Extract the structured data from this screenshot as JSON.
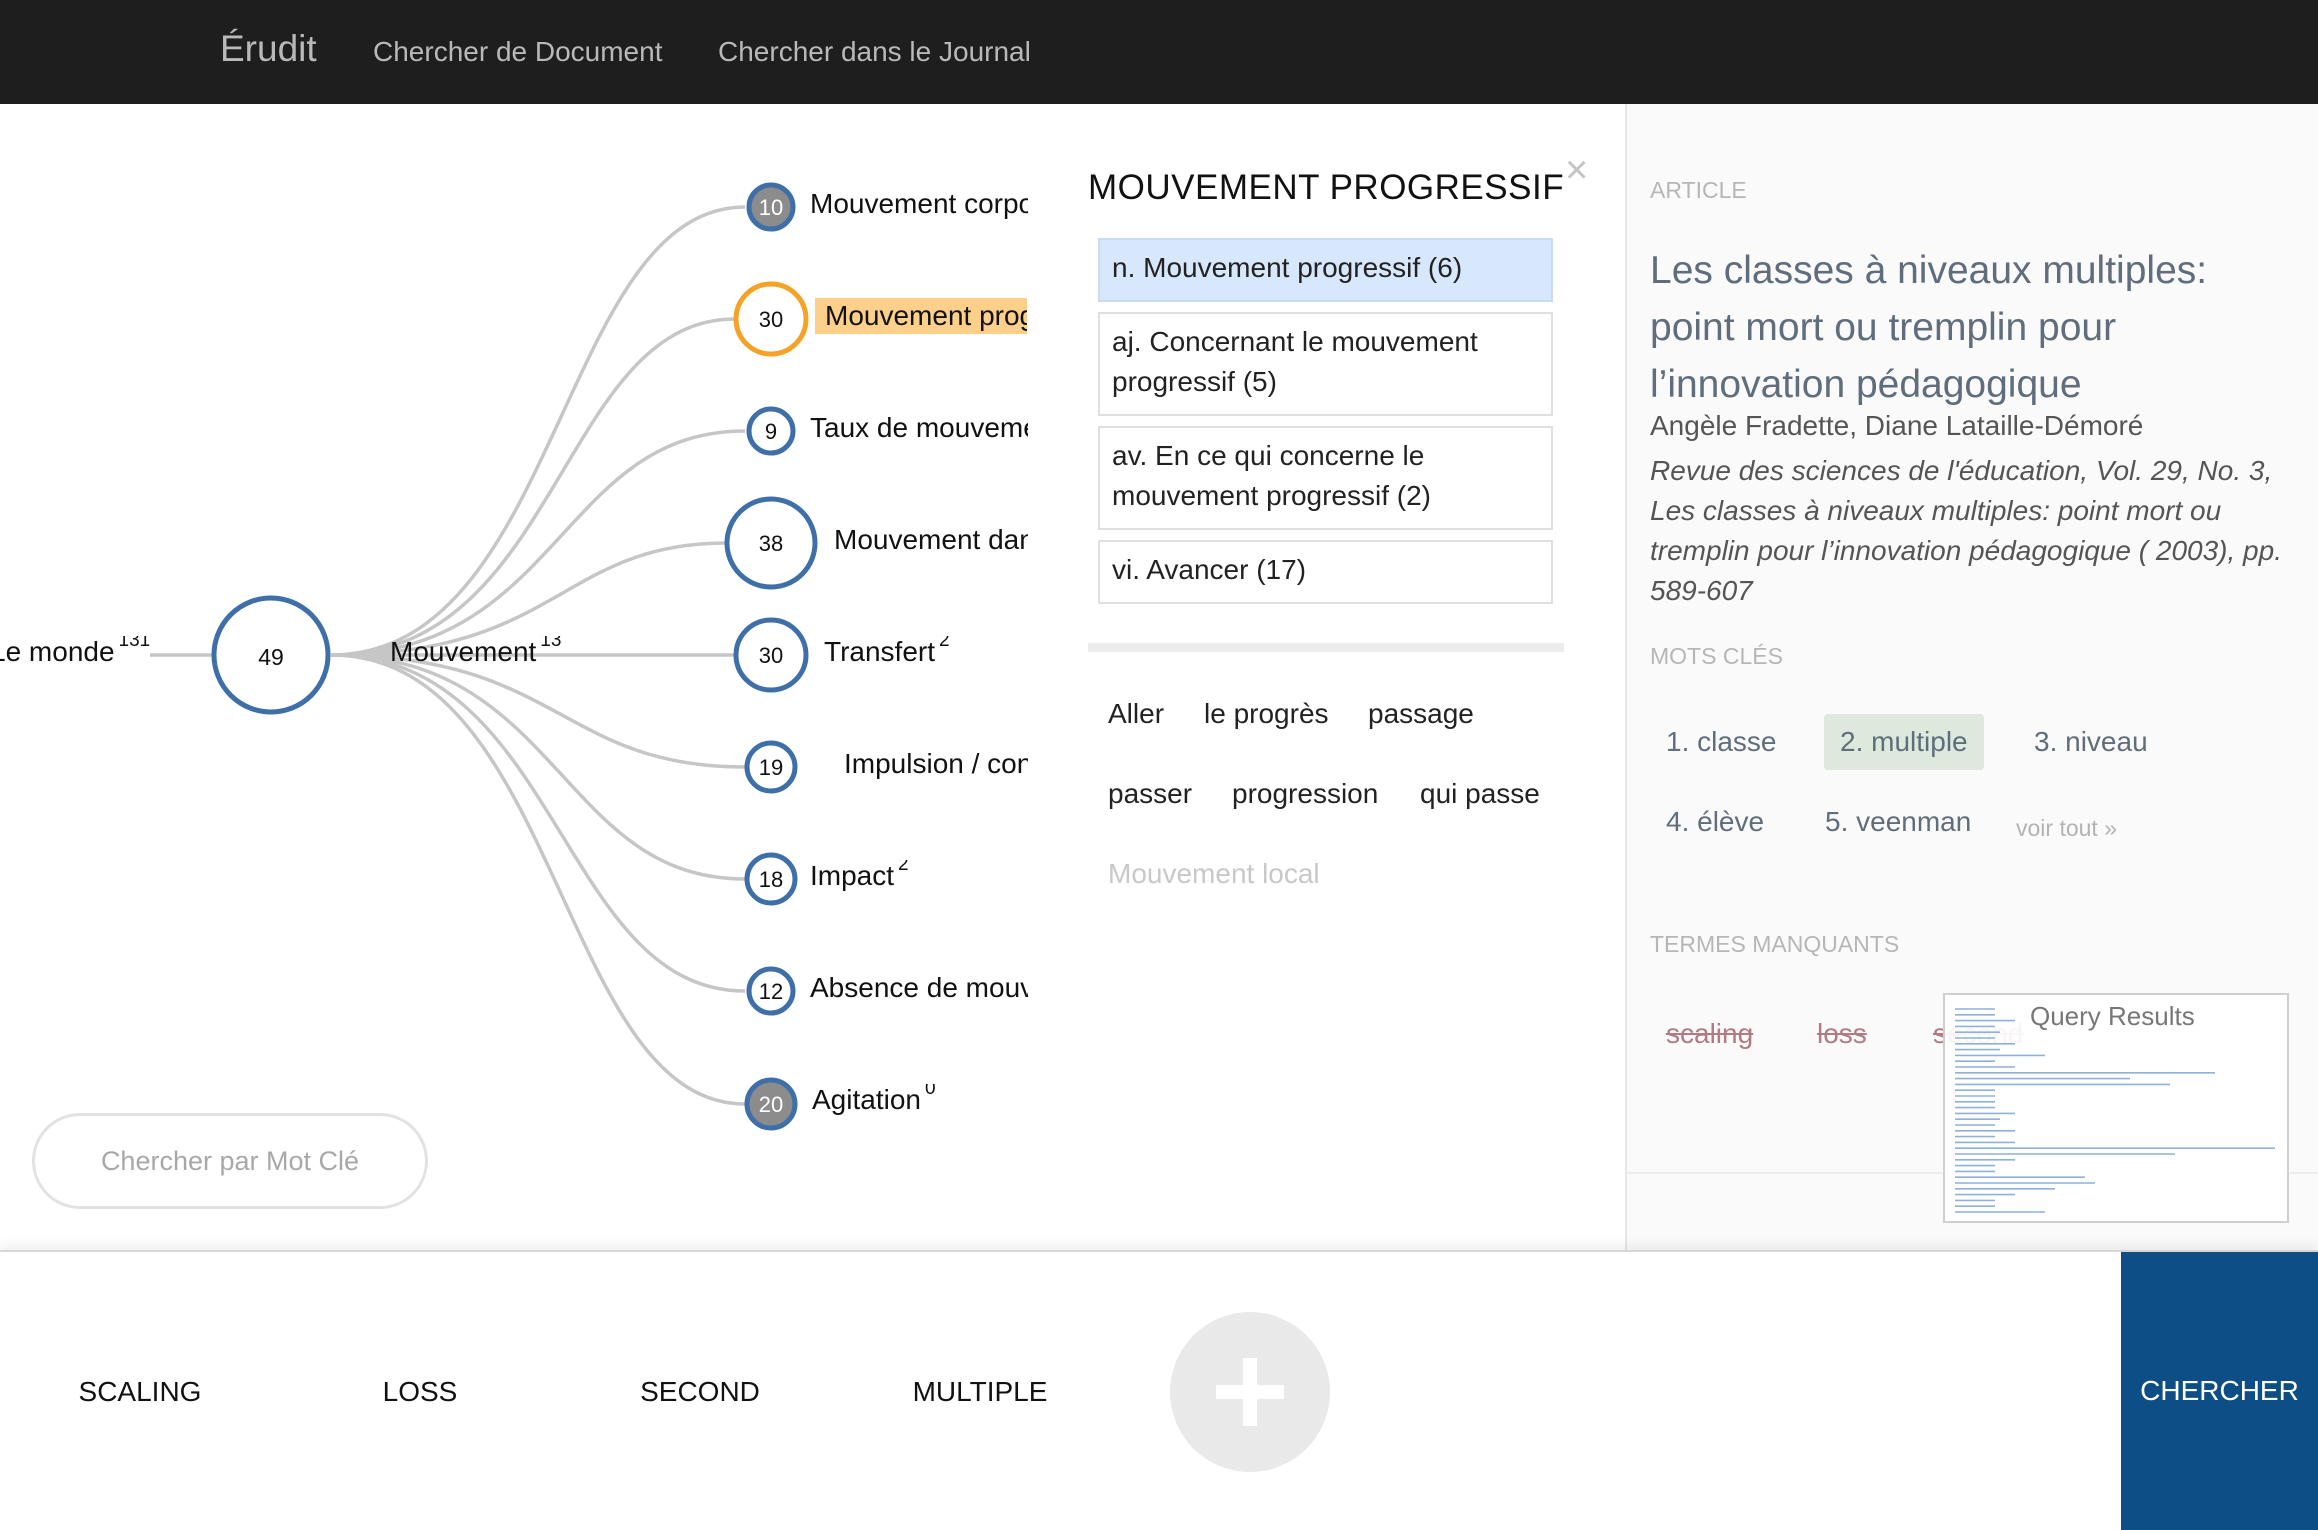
{
  "nav": {
    "brand": "Érudit",
    "links": [
      "Chercher de Document",
      "Chercher dans le Journal"
    ]
  },
  "graph": {
    "root": {
      "label": "Le monde",
      "count": "131"
    },
    "center": {
      "value": "49",
      "label": "Mouvement",
      "count": "13"
    },
    "children": [
      {
        "value": "10",
        "label": "Mouvement corporel",
        "count": "",
        "style": "filled"
      },
      {
        "value": "30",
        "label": "Mouvement progressif",
        "count": "",
        "style": "highlight"
      },
      {
        "value": "9",
        "label": "Taux de mouvement",
        "count": "",
        "style": "outline"
      },
      {
        "value": "38",
        "label": "Mouvement dans l'espace",
        "count": "",
        "style": "outline"
      },
      {
        "value": "30",
        "label": "Transfert",
        "count": "2",
        "style": "outline"
      },
      {
        "value": "19",
        "label": "Impulsion / conduite",
        "count": "",
        "style": "outline"
      },
      {
        "value": "18",
        "label": "Impact",
        "count": "2",
        "style": "outline"
      },
      {
        "value": "12",
        "label": "Absence de mouvement",
        "count": "",
        "style": "outline"
      },
      {
        "value": "20",
        "label": "Agitation",
        "count": "0",
        "style": "filled"
      }
    ],
    "colors": {
      "node": "#3e6fa8",
      "highlight": "#f5a227",
      "filled": "#8c8c8c",
      "edge": "#c6c6c6"
    }
  },
  "keyword_search": {
    "placeholder": "Chercher par Mot Clé"
  },
  "sense_panel": {
    "title": "MOUVEMENT PROGRESSIF",
    "close": "×",
    "senses": [
      "n. Mouvement progressif (6)",
      "aj. Concernant le mouvement progressif (5)",
      "av. En ce qui concerne le mouvement progressif (2)",
      "vi. Avancer (17)"
    ],
    "synonyms": [
      "Aller",
      "le progrès",
      "passage",
      "passer",
      "progression",
      "qui passe",
      "Mouvement local"
    ]
  },
  "article": {
    "section_label": "ARTICLE",
    "title": "Les classes à niveaux multiples: point mort ou tremplin pour l’innovation pédagogique",
    "authors": "Angèle Fradette, Diane Lataille-Démoré",
    "citation": "Revue des sciences de l'éducation, Vol. 29, No. 3, Les classes à niveaux multiples: point mort ou tremplin pour l’innovation pédagogique ( 2003), pp. 589-607"
  },
  "keywords": {
    "section_label": "MOTS CLÉS",
    "items": [
      "1. classe",
      "2. multiple",
      "3. niveau",
      "4. élève",
      "5. veenman"
    ],
    "see_all": "voir tout »"
  },
  "missing_terms": {
    "section_label": "TERMES MANQUANTS",
    "items": [
      "scaling",
      "loss",
      "second"
    ]
  },
  "minimap": {
    "title": "Query Results"
  },
  "query_terms": [
    "SCALING",
    "LOSS",
    "SECOND",
    "MULTIPLE"
  ],
  "search_button": "CHERCHER"
}
